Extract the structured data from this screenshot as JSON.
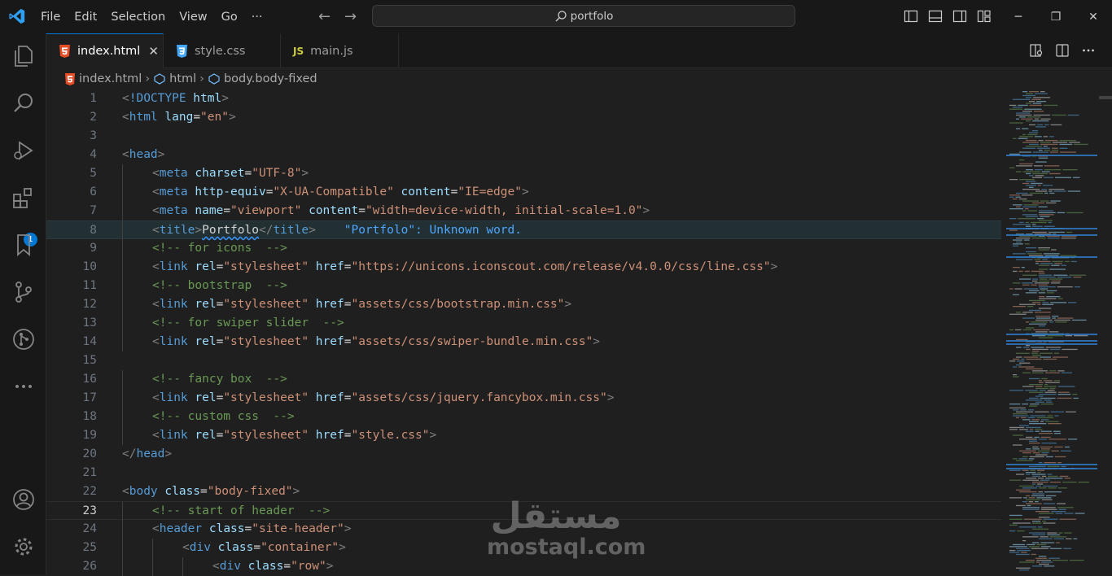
{
  "titlebar": {
    "menu": [
      "File",
      "Edit",
      "Selection",
      "View",
      "Go",
      "···"
    ],
    "search": "portfolo",
    "window_controls": [
      "minimize-icon",
      "restore-icon",
      "close-icon"
    ]
  },
  "activity_bar": {
    "items": [
      "explorer-icon",
      "search-icon",
      "run-debug-icon",
      "extensions-icon",
      "bookmarks-icon",
      "source-control-icon",
      "git-graph-icon",
      "more-icon"
    ],
    "extensions_badge": "1",
    "bottom": [
      "account-icon",
      "settings-gear-icon"
    ]
  },
  "tabs": [
    {
      "label": "index.html",
      "type": "html",
      "active": true,
      "close": "✕"
    },
    {
      "label": "style.css",
      "type": "css",
      "active": false
    },
    {
      "label": "main.js",
      "type": "js",
      "active": false,
      "icon_text": "JS"
    }
  ],
  "breadcrumb": [
    "index.html",
    "html",
    "body.body-fixed"
  ],
  "colors": {
    "accent": "#0078d4",
    "tag": "#569cd6",
    "attr": "#9cdcfe",
    "string": "#ce9178",
    "comment": "#6a9955"
  },
  "editor": {
    "current_line": 23,
    "diagnostic_line": 8,
    "diagnostic": "\"Portfolo\": Unknown word.",
    "lines": [
      {
        "n": "1",
        "t": "<!DOCTYPE html>"
      },
      {
        "n": "2",
        "t": "<html lang=\"en\">"
      },
      {
        "n": "3",
        "t": ""
      },
      {
        "n": "4",
        "t": "<head>"
      },
      {
        "n": "5",
        "t": "<meta charset=\"UTF-8\">"
      },
      {
        "n": "6",
        "t": "<meta http-equiv=\"X-UA-Compatible\" content=\"IE=edge\">"
      },
      {
        "n": "7",
        "t": "<meta name=\"viewport\" content=\"width=device-width, initial-scale=1.0\">"
      },
      {
        "n": "8",
        "t": "<title>Portfolo</title>"
      },
      {
        "n": "9",
        "t": "<!-- for icons  -->"
      },
      {
        "n": "10",
        "t": "<link rel=\"stylesheet\" href=\"https://unicons.iconscout.com/release/v4.0.0/css/line.css\">"
      },
      {
        "n": "11",
        "t": "<!-- bootstrap  -->"
      },
      {
        "n": "12",
        "t": "<link rel=\"stylesheet\" href=\"assets/css/bootstrap.min.css\">"
      },
      {
        "n": "13",
        "t": "<!-- for swiper slider  -->"
      },
      {
        "n": "14",
        "t": "<link rel=\"stylesheet\" href=\"assets/css/swiper-bundle.min.css\">"
      },
      {
        "n": "15",
        "t": ""
      },
      {
        "n": "16",
        "t": "<!-- fancy box  -->"
      },
      {
        "n": "17",
        "t": "<link rel=\"stylesheet\" href=\"assets/css/jquery.fancybox.min.css\">"
      },
      {
        "n": "18",
        "t": "<!-- custom css  -->"
      },
      {
        "n": "19",
        "t": "<link rel=\"stylesheet\" href=\"style.css\">"
      },
      {
        "n": "20",
        "t": "</head>"
      },
      {
        "n": "21",
        "t": ""
      },
      {
        "n": "22",
        "t": "<body class=\"body-fixed\">"
      },
      {
        "n": "23",
        "t": "<!-- start of header  -->"
      },
      {
        "n": "24",
        "t": "<header class=\"site-header\">"
      },
      {
        "n": "25",
        "t": "<div class=\"container\">"
      },
      {
        "n": "26",
        "t": "<div class=\"row\">"
      }
    ]
  },
  "watermark": {
    "arabic": "مستقل",
    "latin": "mostaql.com"
  }
}
